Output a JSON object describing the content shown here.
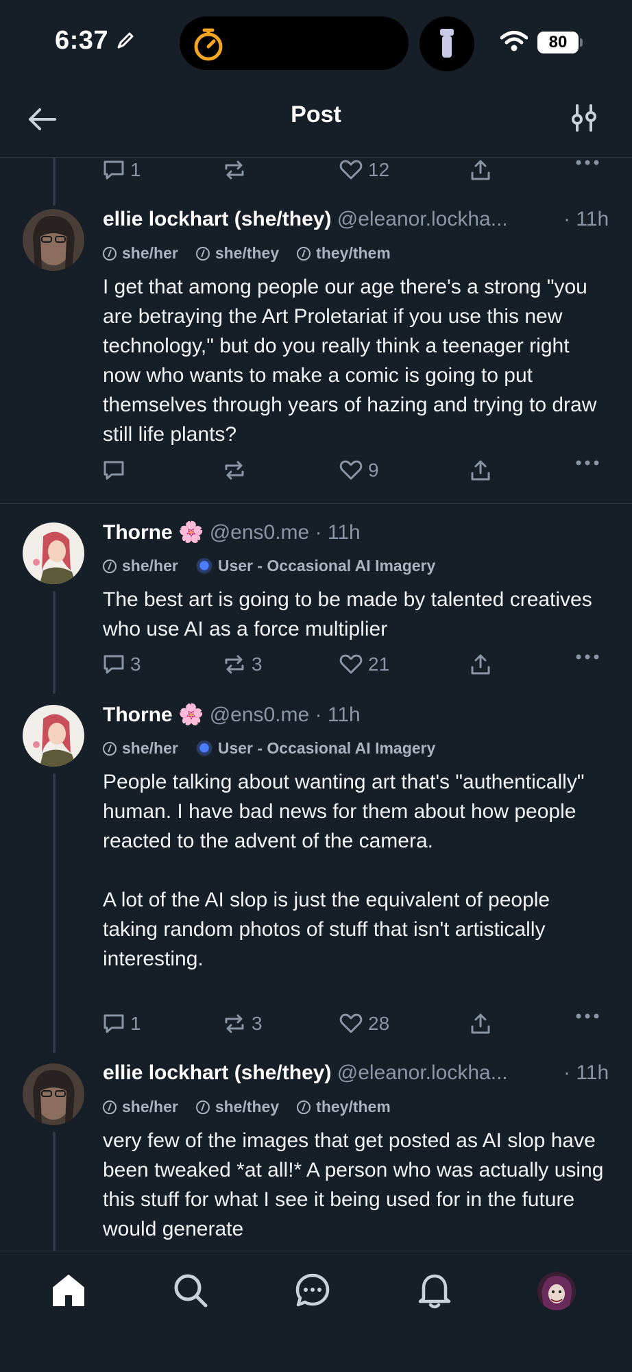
{
  "status_bar": {
    "time": "6:37",
    "battery": "80"
  },
  "header": {
    "title": "Post"
  },
  "top_actions": {
    "replies": "1",
    "reposts": "",
    "likes": "12"
  },
  "posts": [
    {
      "author": "ellie lockhart (she/they)",
      "handle": "@eleanor.lockha...",
      "time": "· 11h",
      "labels": [
        "she/her",
        "she/they",
        "they/them"
      ],
      "text": "I get that among people our age there's a strong \"you are betraying the Art Proletariat if you use this new technology,\" but do you really think a teenager right now who wants to make a comic is going to put themselves through years of hazing and trying to draw still life plants?",
      "replies": "",
      "reposts": "",
      "likes": "9"
    },
    {
      "author": "Thorne 🌸",
      "handle": "@ens0.me",
      "time": "· 11h",
      "labels": [
        "she/her",
        "User - Occasional AI Imagery"
      ],
      "text": "The best art is going to be made by talented creatives who use AI as a force multiplier",
      "replies": "3",
      "reposts": "3",
      "likes": "21"
    },
    {
      "author": "Thorne 🌸",
      "handle": "@ens0.me",
      "time": "· 11h",
      "labels": [
        "she/her",
        "User - Occasional AI Imagery"
      ],
      "text": "People talking about wanting art that's \"authentically\" human. I have bad news for them about how people reacted to the advent of the camera.\n\nA lot of the AI slop is just the equivalent of people taking random photos of stuff that isn't artistically interesting.",
      "replies": "1",
      "reposts": "3",
      "likes": "28"
    },
    {
      "author": "ellie lockhart (she/they)",
      "handle": "@eleanor.lockha...",
      "time": "· 11h",
      "labels": [
        "she/her",
        "she/they",
        "they/them"
      ],
      "text": "very few of the images that get posted as AI slop have been tweaked *at all!* A person who was actually using this stuff for what I see it being used for in the future would generate",
      "replies": "",
      "reposts": "",
      "likes": ""
    }
  ],
  "nav": {
    "items": [
      "home-icon",
      "search-icon",
      "chat-icon",
      "bell-icon",
      "profile-avatar"
    ]
  },
  "colors": {
    "background": "#161e27",
    "divider": "#2a3441",
    "muted": "#8a96a6",
    "accent_orange": "#f5a623"
  }
}
